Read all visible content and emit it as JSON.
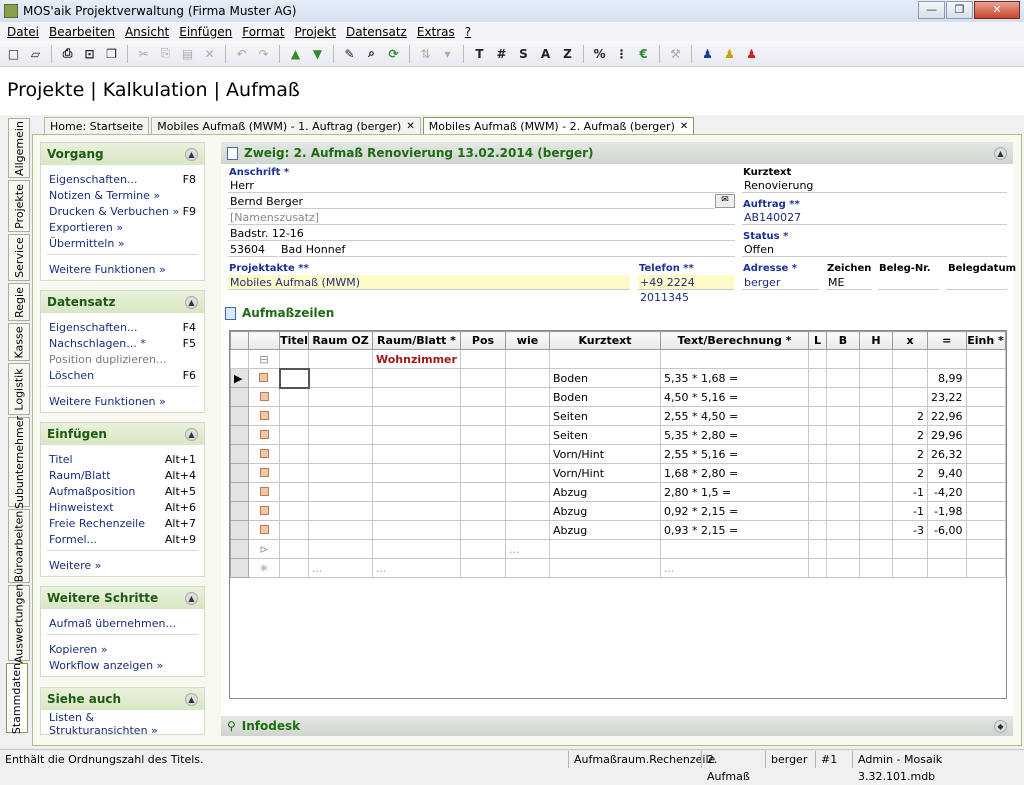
{
  "window": {
    "title": "MOS'aik Projektverwaltung (Firma Muster AG)",
    "btn_min": "—",
    "btn_max": "❐",
    "btn_close": "✕"
  },
  "menu": [
    "Datei",
    "Bearbeiten",
    "Ansicht",
    "Einfügen",
    "Format",
    "Projekt",
    "Datensatz",
    "Extras",
    "?"
  ],
  "toolbar": {
    "letters": [
      "T",
      "#",
      "S",
      "A",
      "Z",
      "%"
    ]
  },
  "page_title": "Projekte | Kalkulation | Aufmaß",
  "vertical_tabs": [
    "Allgemein",
    "Projekte",
    "Service",
    "Regie",
    "Kasse",
    "Logistik",
    "Subunternehmer",
    "Büroarbeiten",
    "Auswertungen",
    "Stammdaten"
  ],
  "doc_tabs": [
    {
      "label": "Home: Startseite",
      "close": ""
    },
    {
      "label": "Mobiles Aufmaß (MWM) - 1. Auftrag (berger)",
      "close": "✕"
    },
    {
      "label": "Mobiles Aufmaß (MWM) - 2. Aufmaß (berger)",
      "close": "✕"
    }
  ],
  "left": {
    "vorgang": {
      "title": "Vorgang",
      "items": [
        {
          "label": "Eigenschaften...",
          "key": "F8"
        },
        {
          "label": "Notizen & Termine »",
          "key": ""
        },
        {
          "label": "Drucken & Verbuchen »",
          "key": "F9"
        },
        {
          "label": "Exportieren »",
          "key": ""
        },
        {
          "label": "Übermitteln »",
          "key": ""
        }
      ],
      "more": "Weitere Funktionen »"
    },
    "datensatz": {
      "title": "Datensatz",
      "items": [
        {
          "label": "Eigenschaften...",
          "key": "F4"
        },
        {
          "label": "Nachschlagen... *",
          "key": "F5"
        },
        {
          "label": "Position duplizieren...",
          "key": ""
        },
        {
          "label": "Löschen",
          "key": "F6"
        }
      ],
      "more": "Weitere Funktionen »"
    },
    "einfuegen": {
      "title": "Einfügen",
      "items": [
        {
          "label": "Titel",
          "key": "Alt+1"
        },
        {
          "label": "Raum/Blatt",
          "key": "Alt+4"
        },
        {
          "label": "Aufmaßposition",
          "key": "Alt+5"
        },
        {
          "label": "Hinweistext",
          "key": "Alt+6"
        },
        {
          "label": "Freie Rechenzeile",
          "key": "Alt+7"
        },
        {
          "label": "Formel...",
          "key": "Alt+9"
        }
      ],
      "more": "Weitere »"
    },
    "schritte": {
      "title": "Weitere Schritte",
      "items": [
        "Aufmaß übernehmen...",
        "Kopieren »",
        "Workflow anzeigen »"
      ]
    },
    "siehe": {
      "title": "Siehe auch",
      "items": [
        "Listen & Strukturansichten »"
      ]
    }
  },
  "header_section": {
    "title": "Zweig: 2. Aufmaß Renovierung 13.02.2014 (berger)",
    "anschrift_label": "Anschrift *",
    "anrede": "Herr",
    "name": "Bernd Berger",
    "zusatz": "[Namenszusatz]",
    "strasse": "Badstr. 12-16",
    "plz": "53604",
    "ort": "Bad Honnef",
    "kurztext_label": "Kurztext",
    "kurztext": "Renovierung",
    "auftrag_label": "Auftrag **",
    "auftrag": "AB140027",
    "status_label": "Status *",
    "status": "Offen",
    "projektakte_label": "Projektakte **",
    "projektakte": "Mobiles Aufmaß (MWM)",
    "telefon_label": "Telefon **",
    "telefon": "+49 2224 2011345",
    "adresse_label": "Adresse *",
    "adresse": "berger",
    "zeichen_label": "Zeichen",
    "zeichen": "ME",
    "belegnr_label": "Beleg-Nr.",
    "belegdatum_label": "Belegdatum"
  },
  "grid": {
    "title": "Aufmaßzeilen",
    "columns": [
      "Titel",
      "Raum OZ",
      "Raum/Blatt *",
      "Pos",
      "wie",
      "Kurztext",
      "Text/Berechnung *",
      "L",
      "B",
      "H",
      "x",
      "=",
      "Einh *"
    ],
    "group_label": "Wohnzimmer",
    "rows": [
      {
        "kurz": "Boden",
        "text": "5,35 * 1,68 =",
        "x": "",
        "eq": "8,99"
      },
      {
        "kurz": "Boden",
        "text": "4,50 * 5,16 =",
        "x": "",
        "eq": "23,22"
      },
      {
        "kurz": "Seiten",
        "text": "2,55 * 4,50 =",
        "x": "2",
        "eq": "22,96"
      },
      {
        "kurz": "Seiten",
        "text": "5,35 * 2,80 =",
        "x": "2",
        "eq": "29,96"
      },
      {
        "kurz": "Vorn/Hint",
        "text": "2,55 * 5,16 =",
        "x": "2",
        "eq": "26,32"
      },
      {
        "kurz": "Vorn/Hint",
        "text": "1,68 * 2,80 =",
        "x": "2",
        "eq": "9,40"
      },
      {
        "kurz": "Abzug",
        "text": "2,80 * 1,5 =",
        "x": "-1",
        "eq": "-4,20"
      },
      {
        "kurz": "Abzug",
        "text": "0,92 * 2,15 =",
        "x": "-1",
        "eq": "-1,98"
      },
      {
        "kurz": "Abzug",
        "text": "0,93 * 2,15 =",
        "x": "-3",
        "eq": "-6,00"
      }
    ],
    "ellipsis": "..."
  },
  "infodesk": "Infodesk",
  "status": [
    "Enthält die Ordnungszahl des Titels.",
    "Aufmaßraum.Rechenzeile",
    "2. Aufmaß",
    "berger",
    "#1",
    "Admin - Mosaik 3.32.101.mdb"
  ]
}
